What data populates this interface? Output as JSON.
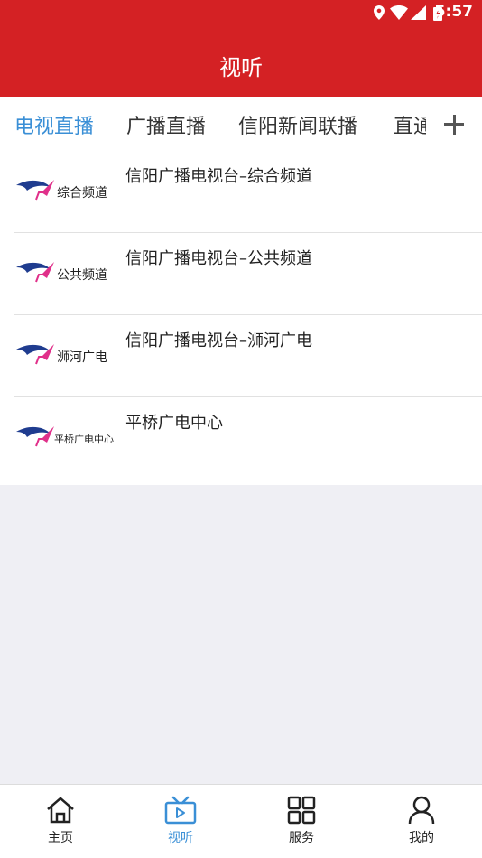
{
  "status_bar": {
    "time": "5:57",
    "icons": [
      "location-icon",
      "wifi-icon",
      "signal-icon",
      "battery-icon"
    ]
  },
  "header": {
    "title": "视听"
  },
  "tabs": [
    {
      "label": "电视直播",
      "active": true
    },
    {
      "label": "广播直播",
      "active": false
    },
    {
      "label": "信阳新闻联播",
      "active": false
    },
    {
      "label": "直通",
      "active": false
    }
  ],
  "add_tab_icon": "plus-icon",
  "channels": [
    {
      "logo_text": "综合频道",
      "name": "信阳广播电视台–综合频道"
    },
    {
      "logo_text": "公共频道",
      "name": "信阳广播电视台–公共频道"
    },
    {
      "logo_text": "浉河广电",
      "name": "信阳广播电视台–浉河广电"
    },
    {
      "logo_text": "平桥广电中心",
      "name": "平桥广电中心"
    }
  ],
  "bottom_nav": [
    {
      "label": "主页",
      "icon": "home-icon",
      "active": false
    },
    {
      "label": "视听",
      "icon": "tv-icon",
      "active": true
    },
    {
      "label": "服务",
      "icon": "grid-icon",
      "active": false
    },
    {
      "label": "我的",
      "icon": "user-icon",
      "active": false
    }
  ],
  "colors": {
    "brand_red": "#d42124",
    "accent_blue": "#3a8fd6",
    "logo_blue": "#1f3c8f",
    "logo_pink": "#e0308a"
  }
}
